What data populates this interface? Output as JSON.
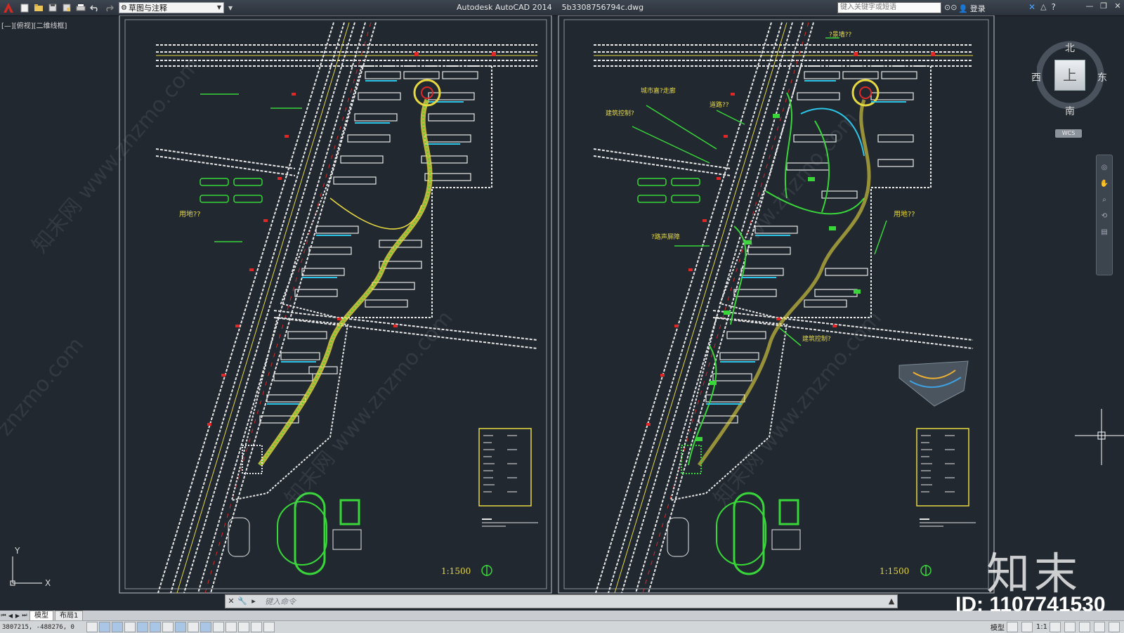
{
  "app": {
    "title": "Autodesk AutoCAD 2014    5b3308756794c.dwg",
    "workspace": "草图与注释",
    "search_placeholder": "键入关键字或短语",
    "login_label": "登录"
  },
  "viewport": {
    "label": "[—][俯视][二维线框]"
  },
  "viewcube": {
    "north": "北",
    "south": "南",
    "east": "东",
    "west": "西",
    "top": "上",
    "wcs": "WCS"
  },
  "drawing": {
    "left_sheet": {
      "labels": [
        "用地??"
      ],
      "scale": "1:1500"
    },
    "right_sheet": {
      "labels": [
        "?景墙??",
        "城市嘉?走廊",
        "道路??",
        "建筑控制?",
        "用地??",
        "?路声屏障",
        "建筑控制?"
      ],
      "scale": "1:1500"
    },
    "colors": {
      "background": "#212830",
      "road": "#e8e8e8",
      "green": "#39d63a",
      "yellow": "#e6d840",
      "red": "#e02828",
      "cyan": "#2cc6e8"
    }
  },
  "command": {
    "placeholder": "键入命令"
  },
  "tabs": [
    "模型",
    "布局1"
  ],
  "status": {
    "coords": "3807215, -488276, 0",
    "model_label": "模型",
    "scale_label": "1:1"
  },
  "watermark": {
    "logo": "知末",
    "id": "ID: 1107741530",
    "site": "www.znzmo.com"
  }
}
